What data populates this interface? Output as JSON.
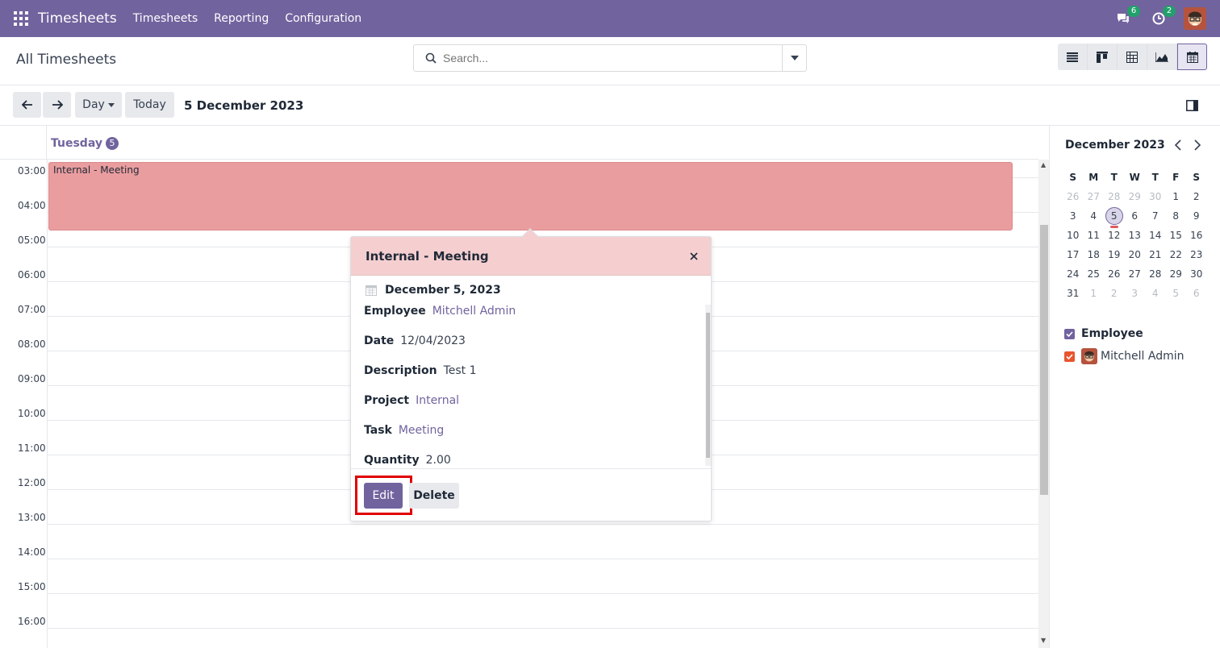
{
  "app": {
    "brand": "Timesheets"
  },
  "menu": [
    {
      "label": "Timesheets"
    },
    {
      "label": "Reporting"
    },
    {
      "label": "Configuration"
    }
  ],
  "systray": {
    "messages_count": "6",
    "activities_count": "2"
  },
  "control_panel": {
    "breadcrumb": "All Timesheets",
    "search_placeholder": "Search..."
  },
  "calendar_nav": {
    "scale_label": "Day",
    "today_label": "Today",
    "date_title": "5 December 2023"
  },
  "day_header": {
    "weekday": "Tuesday",
    "day_number": "5"
  },
  "hours": [
    "03:00",
    "04:00",
    "05:00",
    "06:00",
    "07:00",
    "08:00",
    "09:00",
    "10:00",
    "11:00",
    "12:00",
    "13:00",
    "14:00",
    "15:00",
    "16:00"
  ],
  "event": {
    "title": "Internal - Meeting",
    "color": "#ea9d9f"
  },
  "popover": {
    "title": "Internal - Meeting",
    "date": "December 5, 2023",
    "fields": [
      {
        "label": "Employee",
        "value": "Mitchell Admin",
        "link": true
      },
      {
        "label": "Date",
        "value": "12/04/2023",
        "link": false
      },
      {
        "label": "Description",
        "value": "Test 1",
        "link": false
      },
      {
        "label": "Project",
        "value": "Internal",
        "link": true
      },
      {
        "label": "Task",
        "value": "Meeting",
        "link": true
      },
      {
        "label": "Quantity",
        "value": "2.00",
        "link": false
      }
    ],
    "edit_label": "Edit",
    "delete_label": "Delete"
  },
  "mini_calendar": {
    "month_label": "December 2023",
    "weekdays": [
      "S",
      "M",
      "T",
      "W",
      "T",
      "F",
      "S"
    ],
    "weeks": [
      [
        [
          "26",
          1
        ],
        [
          "27",
          1
        ],
        [
          "28",
          1
        ],
        [
          "29",
          1
        ],
        [
          "30",
          1
        ],
        [
          "1",
          0
        ],
        [
          "2",
          0
        ]
      ],
      [
        [
          "3",
          0
        ],
        [
          "4",
          0
        ],
        [
          "5",
          2
        ],
        [
          "6",
          0
        ],
        [
          "7",
          0
        ],
        [
          "8",
          0
        ],
        [
          "9",
          0
        ]
      ],
      [
        [
          "10",
          0
        ],
        [
          "11",
          0
        ],
        [
          "12",
          0
        ],
        [
          "13",
          0
        ],
        [
          "14",
          0
        ],
        [
          "15",
          0
        ],
        [
          "16",
          0
        ]
      ],
      [
        [
          "17",
          0
        ],
        [
          "18",
          0
        ],
        [
          "19",
          0
        ],
        [
          "20",
          0
        ],
        [
          "21",
          0
        ],
        [
          "22",
          0
        ],
        [
          "23",
          0
        ]
      ],
      [
        [
          "24",
          0
        ],
        [
          "25",
          0
        ],
        [
          "26",
          0
        ],
        [
          "27",
          0
        ],
        [
          "28",
          0
        ],
        [
          "29",
          0
        ],
        [
          "30",
          0
        ]
      ],
      [
        [
          "31",
          0
        ],
        [
          "1",
          1
        ],
        [
          "2",
          1
        ],
        [
          "3",
          1
        ],
        [
          "4",
          1
        ],
        [
          "5",
          1
        ],
        [
          "6",
          1
        ]
      ]
    ]
  },
  "filters": {
    "section_label": "Employee",
    "items": [
      {
        "label": "Mitchell Admin",
        "color": "#e8552d"
      }
    ]
  },
  "colors": {
    "brand": "#71639e",
    "highlight": "#e00000"
  }
}
